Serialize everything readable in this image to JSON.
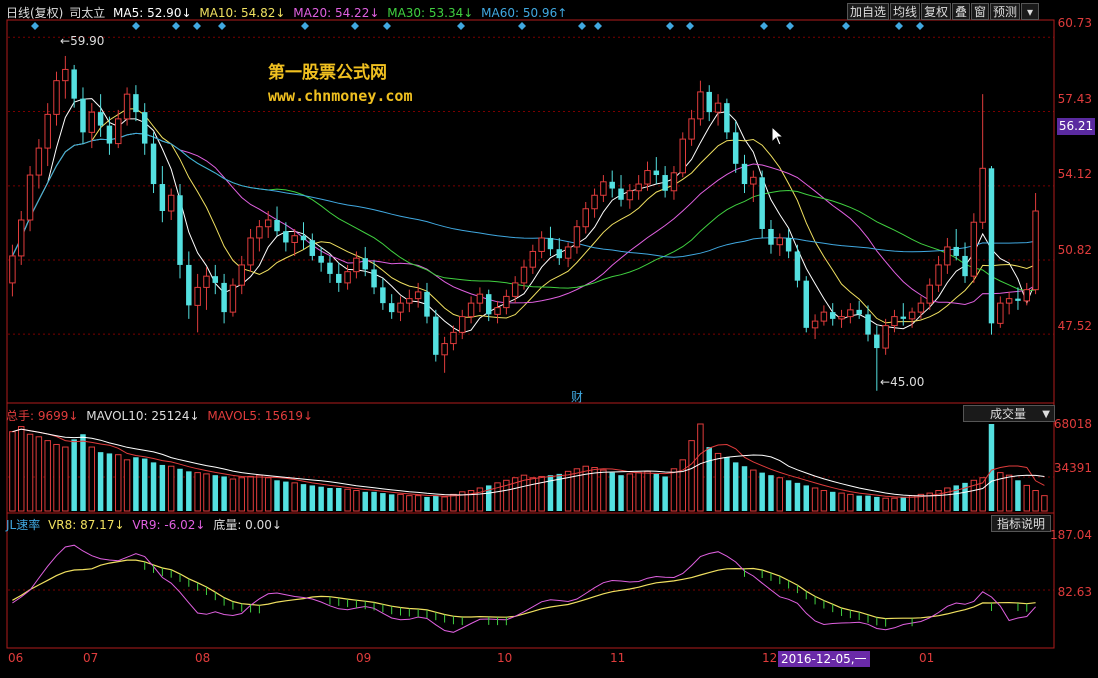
{
  "header": {
    "mode": "日线(复权)",
    "stock": "司太立",
    "ma5": "MA5: 52.90↓",
    "ma10": "MA10: 54.82↓",
    "ma20": "MA20: 54.22↓",
    "ma30": "MA30: 53.34↓",
    "ma60": "MA60: 50.96↑"
  },
  "toolbar": [
    "加自选",
    "均线",
    "复权",
    "叠",
    "窗",
    "预测"
  ],
  "watermark": {
    "line1": "第一股票公式网",
    "line2": "www.chnmoney.com"
  },
  "price_axis": [
    "60.73",
    "57.43",
    "54.12",
    "50.82",
    "47.52"
  ],
  "current_price_tag": "56.21",
  "annotations": {
    "high": "59.90",
    "low": "45.00",
    "finance_marker": "财"
  },
  "volume_panel": {
    "label_total": "总手: 9699↓",
    "label_mavol10": "MAVOL10: 25124↓",
    "label_mavol5": "MAVOL5: 15619↓",
    "selector": "成交量",
    "axis": [
      "68018",
      "34391"
    ]
  },
  "indicator_panel": {
    "label_name": "JL速率",
    "label_vr8": "VR8: 87.17↓",
    "label_vr9": "VR9: -6.02↓",
    "label_bottom": "底量: 0.00↓",
    "help_button": "指标说明",
    "axis": [
      "187.04",
      "82.63"
    ]
  },
  "date_axis": [
    "06",
    "07",
    "08",
    "09",
    "10",
    "11",
    "12",
    "01"
  ],
  "cursor_date": "2016-12-05,一",
  "colors": {
    "up": "#e03c3c",
    "down": "#54e0e0",
    "ma5": "#ffffff",
    "ma10": "#f0e060",
    "ma20": "#e060e0",
    "ma30": "#40d040",
    "ma60": "#40a8e0",
    "grid": "#7a0000",
    "diamond": "#40a8e0"
  },
  "chart_data": {
    "type": "candlestick",
    "ylim": [
      44.5,
      61.5
    ],
    "candles": [
      [
        49.8,
        51.5,
        49.2,
        51.0
      ],
      [
        51.0,
        53.0,
        50.6,
        52.6
      ],
      [
        52.6,
        55.0,
        52.1,
        54.6
      ],
      [
        54.6,
        56.2,
        54.0,
        55.8
      ],
      [
        55.8,
        57.8,
        55.0,
        57.3
      ],
      [
        57.3,
        59.2,
        56.8,
        58.8
      ],
      [
        58.8,
        59.9,
        58.0,
        59.3
      ],
      [
        59.3,
        59.5,
        57.6,
        58.0
      ],
      [
        58.0,
        58.5,
        56.0,
        56.5
      ],
      [
        56.5,
        57.8,
        55.8,
        57.4
      ],
      [
        57.4,
        58.2,
        56.3,
        56.8
      ],
      [
        56.8,
        57.2,
        55.5,
        56.0
      ],
      [
        56.0,
        57.5,
        55.8,
        57.1
      ],
      [
        57.1,
        58.5,
        56.8,
        58.2
      ],
      [
        58.2,
        58.6,
        57.0,
        57.4
      ],
      [
        57.4,
        57.8,
        55.5,
        56.0
      ],
      [
        56.0,
        56.5,
        53.8,
        54.2
      ],
      [
        54.2,
        55.0,
        52.5,
        53.0
      ],
      [
        53.0,
        54.0,
        52.6,
        53.7
      ],
      [
        53.7,
        54.2,
        50.0,
        50.6
      ],
      [
        50.6,
        51.2,
        48.2,
        48.8
      ],
      [
        48.8,
        50.2,
        47.6,
        49.6
      ],
      [
        49.6,
        50.5,
        48.6,
        50.1
      ],
      [
        50.1,
        50.6,
        49.3,
        49.8
      ],
      [
        49.8,
        50.2,
        48.0,
        48.5
      ],
      [
        48.5,
        50.0,
        48.3,
        49.7
      ],
      [
        49.7,
        51.0,
        49.3,
        50.6
      ],
      [
        50.6,
        52.2,
        50.3,
        51.8
      ],
      [
        51.8,
        52.6,
        51.2,
        52.3
      ],
      [
        52.3,
        53.0,
        51.8,
        52.6
      ],
      [
        52.6,
        53.2,
        51.9,
        52.1
      ],
      [
        52.1,
        52.5,
        51.2,
        51.6
      ],
      [
        51.6,
        52.2,
        51.0,
        51.9
      ],
      [
        51.9,
        52.5,
        51.3,
        51.7
      ],
      [
        51.7,
        52.0,
        50.8,
        51.0
      ],
      [
        51.0,
        51.4,
        50.3,
        50.7
      ],
      [
        50.7,
        51.0,
        49.8,
        50.2
      ],
      [
        50.2,
        50.7,
        49.4,
        49.8
      ],
      [
        49.8,
        50.6,
        49.5,
        50.3
      ],
      [
        50.3,
        51.2,
        50.0,
        50.9
      ],
      [
        50.9,
        51.4,
        50.1,
        50.4
      ],
      [
        50.4,
        50.8,
        49.3,
        49.6
      ],
      [
        49.6,
        50.0,
        48.6,
        48.9
      ],
      [
        48.9,
        49.3,
        48.2,
        48.5
      ],
      [
        48.5,
        49.2,
        48.1,
        48.9
      ],
      [
        48.9,
        49.5,
        48.5,
        49.1
      ],
      [
        49.1,
        49.8,
        48.7,
        49.4
      ],
      [
        49.4,
        49.8,
        48.0,
        48.3
      ],
      [
        48.3,
        48.6,
        46.3,
        46.6
      ],
      [
        46.6,
        47.4,
        45.8,
        47.1
      ],
      [
        47.1,
        47.9,
        46.8,
        47.6
      ],
      [
        47.6,
        48.6,
        47.3,
        48.3
      ],
      [
        48.3,
        49.2,
        48.0,
        48.9
      ],
      [
        48.9,
        49.6,
        48.5,
        49.3
      ],
      [
        49.3,
        49.5,
        48.1,
        48.4
      ],
      [
        48.4,
        49.0,
        48.0,
        48.7
      ],
      [
        48.7,
        49.5,
        48.4,
        49.2
      ],
      [
        49.2,
        50.1,
        48.9,
        49.8
      ],
      [
        49.8,
        50.8,
        49.5,
        50.5
      ],
      [
        50.5,
        51.5,
        50.2,
        51.2
      ],
      [
        51.2,
        52.1,
        50.9,
        51.8
      ],
      [
        51.8,
        52.3,
        51.0,
        51.3
      ],
      [
        51.3,
        51.8,
        50.6,
        50.9
      ],
      [
        50.9,
        51.6,
        50.5,
        51.4
      ],
      [
        51.4,
        52.6,
        51.1,
        52.3
      ],
      [
        52.3,
        53.4,
        52.0,
        53.1
      ],
      [
        53.1,
        54.0,
        52.7,
        53.7
      ],
      [
        53.7,
        54.6,
        53.4,
        54.3
      ],
      [
        54.3,
        54.8,
        53.6,
        54.0
      ],
      [
        54.0,
        54.6,
        53.2,
        53.5
      ],
      [
        53.5,
        54.2,
        53.1,
        53.9
      ],
      [
        53.9,
        54.6,
        53.5,
        54.2
      ],
      [
        54.2,
        55.2,
        53.9,
        54.8
      ],
      [
        54.8,
        55.4,
        54.2,
        54.6
      ],
      [
        54.6,
        55.0,
        53.6,
        53.9
      ],
      [
        53.9,
        55.0,
        53.5,
        54.7
      ],
      [
        54.7,
        56.5,
        54.5,
        56.2
      ],
      [
        56.2,
        57.5,
        55.9,
        57.1
      ],
      [
        57.1,
        58.8,
        56.8,
        58.3
      ],
      [
        58.3,
        58.6,
        57.0,
        57.4
      ],
      [
        57.4,
        58.2,
        56.8,
        57.8
      ],
      [
        57.8,
        58.0,
        56.2,
        56.5
      ],
      [
        56.5,
        57.0,
        54.7,
        55.1
      ],
      [
        55.1,
        55.5,
        53.8,
        54.2
      ],
      [
        54.2,
        54.8,
        53.4,
        54.5
      ],
      [
        54.5,
        54.8,
        51.8,
        52.2
      ],
      [
        52.2,
        52.6,
        51.1,
        51.5
      ],
      [
        51.5,
        52.0,
        51.0,
        51.8
      ],
      [
        51.8,
        52.2,
        50.9,
        51.2
      ],
      [
        51.2,
        51.5,
        49.6,
        49.9
      ],
      [
        49.9,
        50.1,
        47.6,
        47.8
      ],
      [
        47.8,
        48.4,
        47.3,
        48.1
      ],
      [
        48.1,
        48.8,
        47.9,
        48.5
      ],
      [
        48.5,
        48.9,
        47.9,
        48.2
      ],
      [
        48.2,
        48.6,
        47.8,
        48.3
      ],
      [
        48.3,
        48.9,
        48.0,
        48.6
      ],
      [
        48.6,
        49.0,
        48.2,
        48.4
      ],
      [
        48.4,
        48.8,
        47.2,
        47.5
      ],
      [
        47.5,
        47.9,
        45.0,
        46.9
      ],
      [
        46.9,
        48.2,
        46.6,
        47.9
      ],
      [
        47.9,
        48.6,
        47.6,
        48.3
      ],
      [
        48.3,
        48.9,
        47.9,
        48.2
      ],
      [
        48.2,
        48.7,
        47.8,
        48.5
      ],
      [
        48.5,
        49.2,
        48.2,
        48.9
      ],
      [
        48.9,
        50.0,
        48.6,
        49.7
      ],
      [
        49.7,
        51.0,
        49.4,
        50.6
      ],
      [
        50.6,
        51.8,
        50.2,
        51.4
      ],
      [
        51.4,
        52.2,
        50.8,
        51.0
      ],
      [
        51.0,
        51.6,
        49.8,
        50.1
      ],
      [
        50.1,
        52.9,
        49.8,
        52.5
      ],
      [
        52.5,
        58.2,
        52.2,
        54.9
      ],
      [
        54.9,
        55.0,
        47.5,
        48.0
      ],
      [
        48.0,
        49.2,
        47.8,
        48.9
      ],
      [
        48.9,
        49.4,
        48.4,
        49.1
      ],
      [
        49.1,
        49.6,
        48.6,
        49.0
      ],
      [
        49.0,
        49.8,
        48.8,
        49.5
      ],
      [
        49.5,
        53.8,
        49.3,
        53.0
      ]
    ],
    "volume": [
      62,
      66,
      60,
      58,
      55,
      52,
      50,
      56,
      60,
      50,
      46,
      45,
      44,
      40,
      42,
      41,
      38,
      36,
      35,
      33,
      31,
      30,
      29,
      28,
      27,
      25,
      26,
      27,
      28,
      26,
      24,
      23,
      22,
      21,
      20,
      19,
      18,
      18,
      17,
      16,
      15,
      15,
      14,
      13,
      13,
      12,
      12,
      11,
      12,
      11,
      13,
      15,
      16,
      18,
      20,
      22,
      24,
      26,
      28,
      26,
      27,
      28,
      29,
      31,
      33,
      35,
      34,
      32,
      30,
      28,
      29,
      30,
      31,
      29,
      27,
      33,
      40,
      55,
      68,
      50,
      45,
      42,
      38,
      35,
      32,
      30,
      28,
      26,
      24,
      22,
      20,
      18,
      16,
      15,
      14,
      13,
      12,
      12,
      11,
      10,
      10,
      11,
      12,
      13,
      14,
      16,
      18,
      20,
      22,
      24,
      26,
      68,
      30,
      28,
      24,
      20,
      16,
      12
    ]
  }
}
